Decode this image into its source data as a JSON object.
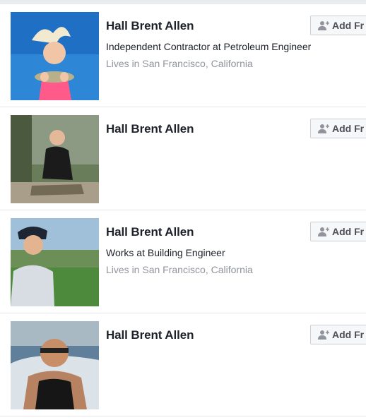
{
  "results": [
    {
      "name": "Hall Brent Allen",
      "subtitle": "Independent Contractor at Petroleum Engineer",
      "location": "Lives in San Francisco, California",
      "button_label": "Add Fr",
      "button_icon": "add-friend-icon"
    },
    {
      "name": "Hall Brent Allen",
      "subtitle": "",
      "location": "",
      "button_label": "Add Fr",
      "button_icon": "add-friend-icon"
    },
    {
      "name": "Hall Brent Allen",
      "subtitle": "Works at Building Engineer",
      "location": "Lives in San Francisco, California",
      "button_label": "Add Fr",
      "button_icon": "add-friend-icon"
    },
    {
      "name": "Hall Brent Allen",
      "subtitle": "",
      "location": "",
      "button_label": "Add Fr",
      "button_icon": "add-friend-icon"
    }
  ],
  "colors": {
    "name_text": "#1d2129",
    "meta_text": "#90949c",
    "button_bg": "#f6f7f9",
    "button_border": "#ccd0d5",
    "page_bg": "#e9ebee"
  }
}
